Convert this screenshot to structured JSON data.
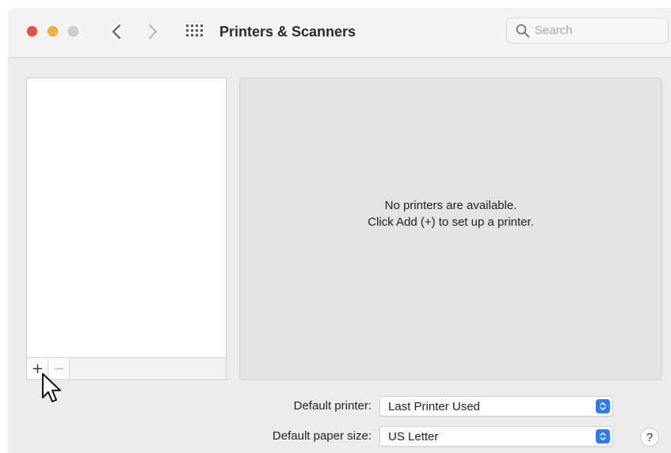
{
  "window": {
    "title": "Printers & Scanners",
    "search_placeholder": "Search"
  },
  "icons": {
    "close": "close-button",
    "minimize": "minimize-button",
    "zoom": "zoom-button-disabled",
    "back": "chevron-left-icon",
    "forward": "chevron-right-icon",
    "grid": "grid-icon",
    "search": "magnifier-icon",
    "add": "plus-icon",
    "remove": "minus-icon",
    "stepper": "up-down-chevrons-icon",
    "cursor": "arrow-pointer-icon"
  },
  "printer_list": {
    "add_label": "+",
    "remove_label": "−"
  },
  "detail": {
    "empty_line1": "No printers are available.",
    "empty_line2": "Click Add (+) to set up a printer."
  },
  "settings": {
    "default_printer_label": "Default printer:",
    "default_printer_value": "Last Printer Used",
    "default_paper_label": "Default paper size:",
    "default_paper_value": "US Letter"
  },
  "help": {
    "label": "?"
  },
  "colors": {
    "close": "#e9524a",
    "minimize": "#f4b43e",
    "zoom_disabled": "#cfcfcf",
    "accent": "#2f7bf6"
  }
}
